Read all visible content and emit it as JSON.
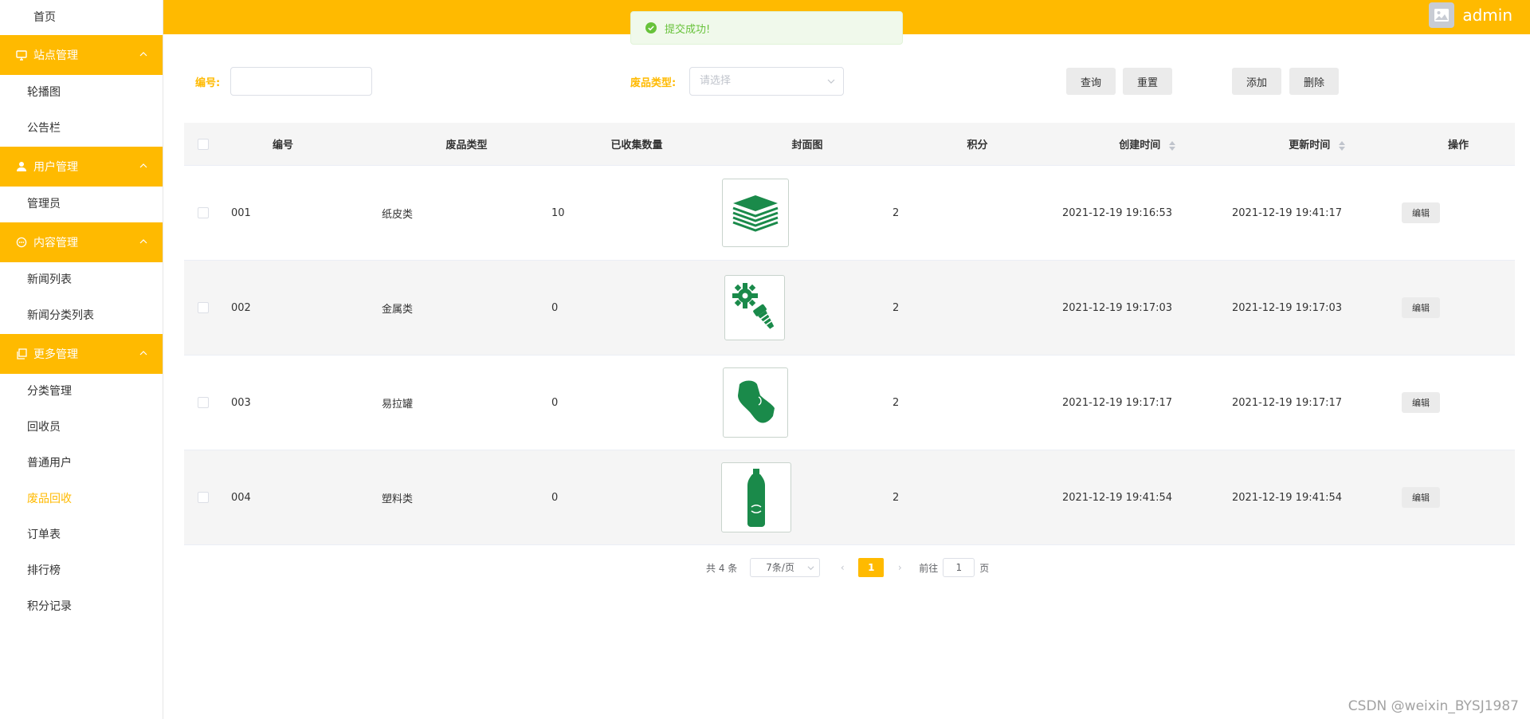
{
  "sidebar": {
    "home": "首页",
    "groups": [
      {
        "title": "站点管理",
        "icon": "monitor-icon",
        "items": [
          "轮播图",
          "公告栏"
        ]
      },
      {
        "title": "用户管理",
        "icon": "user-icon",
        "items": [
          "管理员"
        ]
      },
      {
        "title": "内容管理",
        "icon": "chat-icon",
        "items": [
          "新闻列表",
          "新闻分类列表"
        ]
      },
      {
        "title": "更多管理",
        "icon": "copy-icon",
        "items": [
          "分类管理",
          "回收员",
          "普通用户",
          "废品回收",
          "订单表",
          "排行榜",
          "积分记录"
        ]
      }
    ],
    "active_item": "废品回收"
  },
  "header": {
    "username": "admin"
  },
  "toast": {
    "message": "提交成功!"
  },
  "search": {
    "id_label": "编号:",
    "id_value": "",
    "type_label": "废品类型:",
    "type_placeholder": "请选择",
    "query_label": "查询",
    "reset_label": "重置",
    "add_label": "添加",
    "delete_label": "删除"
  },
  "table": {
    "headers": {
      "id": "编号",
      "type": "废品类型",
      "collected": "已收集数量",
      "cover": "封面图",
      "points": "积分",
      "created": "创建时间",
      "updated": "更新时间",
      "actions": "操作"
    },
    "rows": [
      {
        "id": "001",
        "type": "纸皮类",
        "collected": "10",
        "cover_icon": "paper-stack-icon",
        "points": "2",
        "created": "2021-12-19 19:16:53",
        "updated": "2021-12-19 19:41:17",
        "edit": "编辑"
      },
      {
        "id": "002",
        "type": "金属类",
        "collected": "0",
        "cover_icon": "metal-gear-screw-icon",
        "points": "2",
        "created": "2021-12-19 19:17:03",
        "updated": "2021-12-19 19:17:03",
        "edit": "编辑"
      },
      {
        "id": "003",
        "type": "易拉罐",
        "collected": "0",
        "cover_icon": "crushed-can-icon",
        "points": "2",
        "created": "2021-12-19 19:17:17",
        "updated": "2021-12-19 19:17:17",
        "edit": "编辑"
      },
      {
        "id": "004",
        "type": "塑料类",
        "collected": "0",
        "cover_icon": "plastic-bottle-icon",
        "points": "2",
        "created": "2021-12-19 19:41:54",
        "updated": "2021-12-19 19:41:54",
        "edit": "编辑"
      }
    ]
  },
  "pagination": {
    "total_text": "共 4 条",
    "page_size": "7条/页",
    "prev": "‹",
    "current": "1",
    "next": "›",
    "goto_label": "前往",
    "goto_value": "1",
    "page_suffix": "页"
  },
  "watermark": "CSDN @weixin_BYSJ1987",
  "colors": {
    "accent": "#ffba00",
    "success": "#67c23a",
    "icon_green": "#1a8a4a"
  }
}
